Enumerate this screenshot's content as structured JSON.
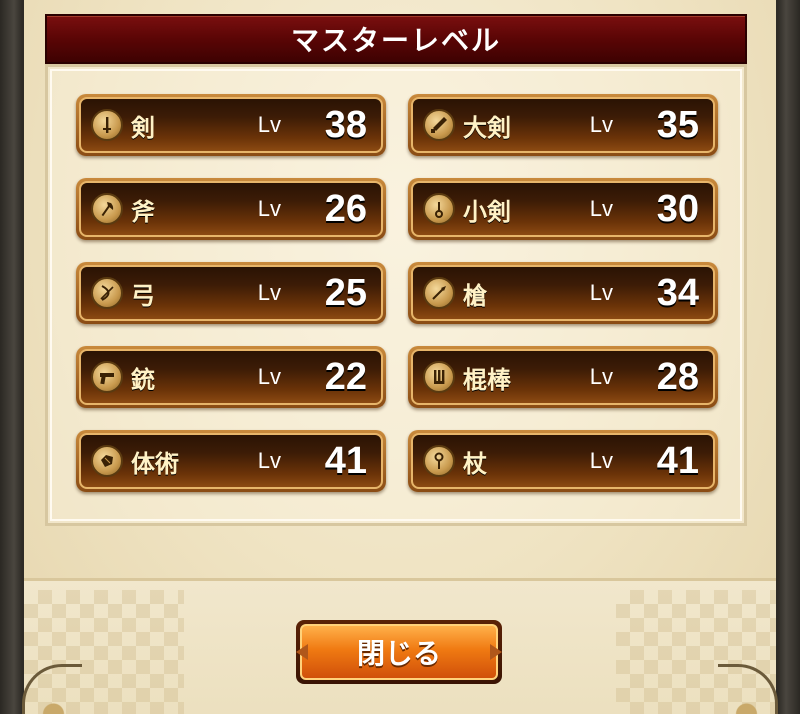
{
  "title": "マスターレベル",
  "lv_label": "Lv",
  "weapons": [
    {
      "name": "剣",
      "level": "38",
      "icon": "sword-icon"
    },
    {
      "name": "大剣",
      "level": "35",
      "icon": "greatsword-icon"
    },
    {
      "name": "斧",
      "level": "26",
      "icon": "axe-icon"
    },
    {
      "name": "小剣",
      "level": "30",
      "icon": "dagger-icon"
    },
    {
      "name": "弓",
      "level": "25",
      "icon": "bow-icon"
    },
    {
      "name": "槍",
      "level": "34",
      "icon": "spear-icon"
    },
    {
      "name": "銃",
      "level": "22",
      "icon": "gun-icon"
    },
    {
      "name": "棍棒",
      "level": "28",
      "icon": "club-icon"
    },
    {
      "name": "体術",
      "level": "41",
      "icon": "fist-icon"
    },
    {
      "name": "杖",
      "level": "41",
      "icon": "staff-icon"
    }
  ],
  "close_button": {
    "label": "閉じる"
  },
  "colors": {
    "title_bar": "#5a0505",
    "badge_gold": "#c98a3c",
    "button_orange": "#f07a12"
  }
}
